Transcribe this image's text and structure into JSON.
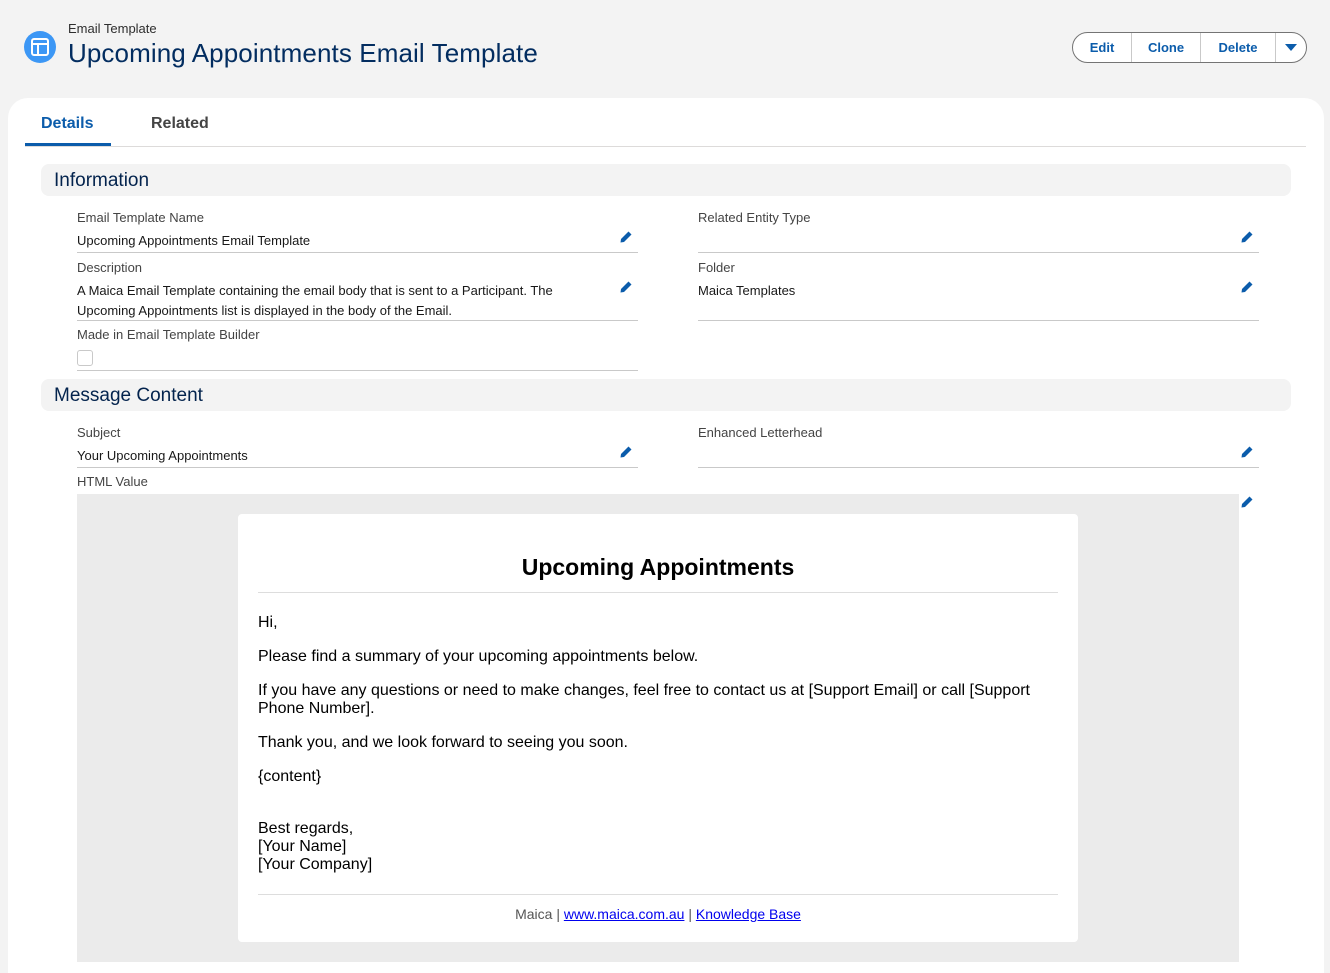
{
  "header": {
    "object_type": "Email Template",
    "title": "Upcoming Appointments Email Template",
    "actions": {
      "edit": "Edit",
      "clone": "Clone",
      "delete": "Delete"
    }
  },
  "tabs": {
    "details": "Details",
    "related": "Related"
  },
  "sections": {
    "information": {
      "title": "Information",
      "email_template_name": {
        "label": "Email Template Name",
        "value": "Upcoming Appointments Email Template"
      },
      "related_entity_type": {
        "label": "Related Entity Type",
        "value": ""
      },
      "description": {
        "label": "Description",
        "value": "A Maica Email Template containing the email body that is sent to a Participant. The Upcoming Appointments list is displayed in the body of the Email."
      },
      "folder": {
        "label": "Folder",
        "value": "Maica Templates"
      },
      "made_in_builder": {
        "label": "Made in Email Template Builder",
        "checked": false
      }
    },
    "message_content": {
      "title": "Message Content",
      "subject": {
        "label": "Subject",
        "value": "Your Upcoming Appointments"
      },
      "enhanced_letterhead": {
        "label": "Enhanced Letterhead",
        "value": ""
      },
      "html_value": {
        "label": "HTML Value"
      }
    }
  },
  "email_preview": {
    "heading": "Upcoming Appointments",
    "greeting": "Hi,",
    "para1": "Please find a summary of your upcoming appointments below.",
    "para2": "If you have any questions or need to make changes, feel free to contact us at [Support Email] or call [Support Phone Number].",
    "para3": "Thank you, and we look forward to seeing you soon.",
    "content_token": "{content}",
    "signoff": "Best regards,",
    "sign_name": "[Your Name]",
    "sign_company": "[Your Company]",
    "footer": {
      "brand": "Maica",
      "separator": "|",
      "website": "www.maica.com.au",
      "knowledge_base": "Knowledge Base"
    }
  },
  "colors": {
    "brand_blue": "#0b5cab",
    "title_navy": "#032d60",
    "icon_blue": "#3c97f5",
    "page_bg": "#f3f3f3"
  },
  "icons": {
    "header": "email-template-icon",
    "edit_field": "pencil-icon",
    "more_actions": "chevron-down-icon"
  }
}
